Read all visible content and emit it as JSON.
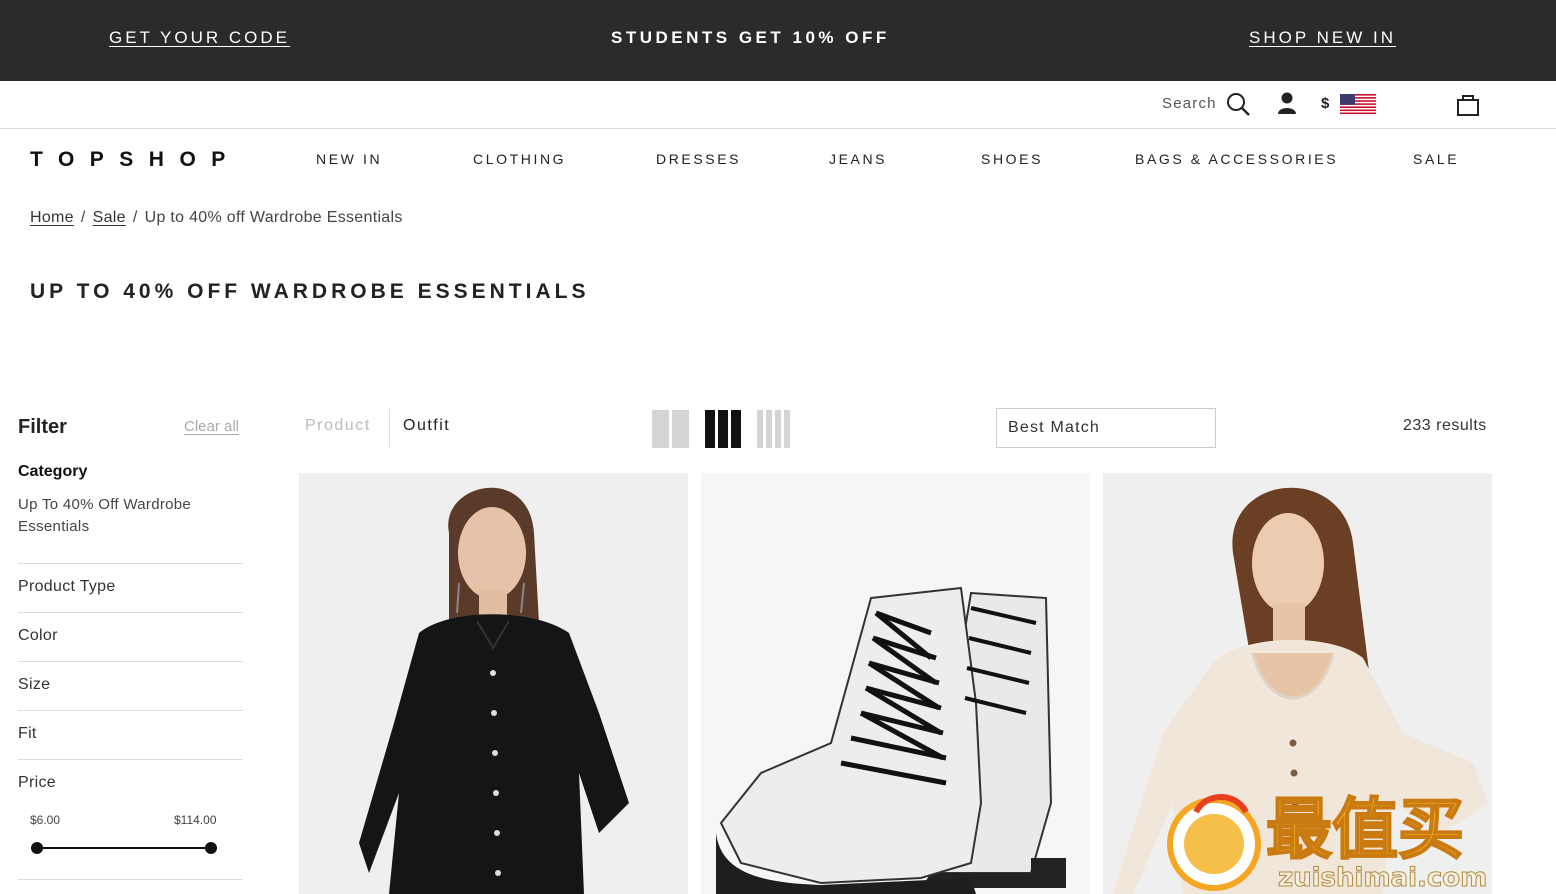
{
  "promo": {
    "left_link": "GET YOUR CODE",
    "center_text": "STUDENTS GET 10% OFF",
    "right_link": "SHOP NEW IN"
  },
  "utility": {
    "search_label": "Search",
    "currency_symbol": "$",
    "icons": [
      "search-icon",
      "user-icon",
      "us-flag-icon",
      "shopping-bag-icon"
    ]
  },
  "brand": {
    "logo": "TOPSHOP"
  },
  "nav": {
    "items": [
      "NEW IN",
      "CLOTHING",
      "DRESSES",
      "JEANS",
      "SHOES",
      "BAGS & ACCESSORIES",
      "SALE"
    ]
  },
  "breadcrumb": {
    "home": "Home",
    "separator": "/",
    "sale": "Sale",
    "current": "Up to 40% off Wardrobe Essentials"
  },
  "page": {
    "title": "UP TO 40% OFF WARDROBE ESSENTIALS"
  },
  "filter": {
    "title": "Filter",
    "clear_all": "Clear all",
    "category_title": "Category",
    "category_value": "Up To 40% Off Wardrobe Essentials",
    "facets": [
      "Product Type",
      "Color",
      "Size",
      "Fit",
      "Price"
    ],
    "price": {
      "min_label": "$6.00",
      "max_label": "$114.00",
      "min": 6,
      "max": 114
    }
  },
  "toolbar": {
    "view_product": "Product",
    "view_outfit": "Outfit",
    "selected_view": "Outfit",
    "grid_options": [
      2,
      3,
      4
    ],
    "selected_grid": 3,
    "sort_value": "Best Match",
    "results": "233 results"
  },
  "products": [
    {
      "image": "black-blouse-model"
    },
    {
      "image": "white-lace-up-boots"
    },
    {
      "image": "cream-ribbed-cardigan-model"
    }
  ],
  "watermark": {
    "text": "最值买",
    "domain": "zuishimai.com"
  },
  "colors": {
    "promo_bg": "#2b2b2b",
    "text_dark": "#222222",
    "muted": "#aaaaaa",
    "tile_bg": "#efefef",
    "watermark_orange": "#f5a623"
  }
}
